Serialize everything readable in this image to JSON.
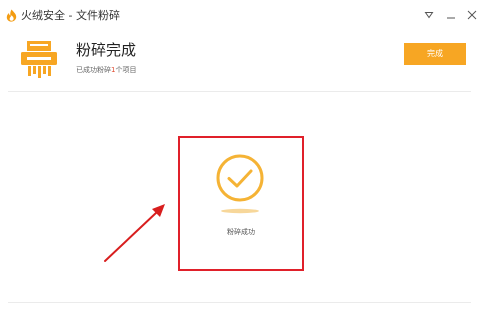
{
  "window": {
    "title": "火绒安全 - 文件粉碎"
  },
  "header": {
    "title": "粉碎完成",
    "subtitle_prefix": "已成功粉碎",
    "subtitle_count": "1",
    "subtitle_suffix": "个项目",
    "done_button": "完成"
  },
  "main": {
    "status_text": "粉碎成功"
  },
  "icons": {
    "app_logo": "huorong-flame-logo",
    "menu": "menu-triangle-icon",
    "minimize": "minimize-icon",
    "close": "close-icon",
    "shredder": "shredder-icon",
    "success": "success-check-icon",
    "annotation": "red-arrow-annotation"
  },
  "colors": {
    "accent": "#f7a623",
    "highlight": "#e0202a",
    "count": "#e24b2f"
  }
}
